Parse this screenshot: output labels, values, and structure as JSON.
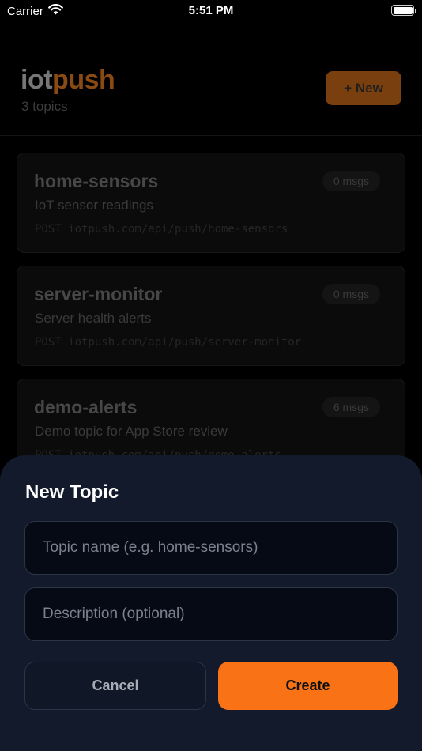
{
  "status_bar": {
    "carrier": "Carrier",
    "time": "5:51 PM",
    "icons": [
      "wifi-icon",
      "battery-icon"
    ]
  },
  "header": {
    "brand_part1": "iot",
    "brand_part2": "push",
    "subtitle": "3 topics",
    "new_button_label": "+ New"
  },
  "topics": [
    {
      "name": "home-sensors",
      "description": "IoT sensor readings",
      "endpoint": "POST iotpush.com/api/push/home-sensors",
      "count": "0 msgs"
    },
    {
      "name": "server-monitor",
      "description": "Server health alerts",
      "endpoint": "POST iotpush.com/api/push/server-monitor",
      "count": "0 msgs"
    },
    {
      "name": "demo-alerts",
      "description": "Demo topic for App Store review",
      "endpoint": "POST iotpush.com/api/push/demo-alerts",
      "count": "6 msgs"
    }
  ],
  "sheet": {
    "title": "New Topic",
    "name_placeholder": "Topic name (e.g. home-sensors)",
    "description_placeholder": "Description (optional)",
    "cancel_label": "Cancel",
    "create_label": "Create"
  },
  "colors": {
    "accent": "#f97316",
    "sheet_background": "#131a2b",
    "app_background": "#000000"
  }
}
